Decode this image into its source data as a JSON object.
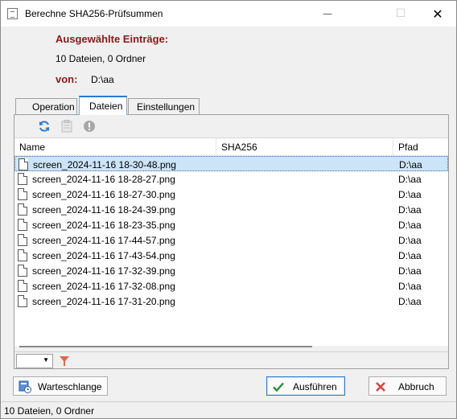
{
  "window": {
    "title": "Berechne SHA256-Prüfsummen"
  },
  "header": {
    "selected_label": "Ausgewählte Einträge:",
    "selected_summary": "10 Dateien, 0 Ordner",
    "from_label": "von:",
    "from_value": "D:\\aa"
  },
  "tabs": [
    {
      "label": "Operation",
      "active": false
    },
    {
      "label": "Dateien",
      "active": true
    },
    {
      "label": "Einstellungen",
      "active": false
    }
  ],
  "toolbar": {
    "icons": [
      "refresh-icon",
      "clipboard-icon",
      "info-icon"
    ]
  },
  "list": {
    "columns": [
      "Name",
      "SHA256",
      "Pfad"
    ],
    "rows": [
      {
        "name": "screen_2024-11-16 18-30-48.png",
        "sha256": "",
        "path": "D:\\aa",
        "selected": true
      },
      {
        "name": "screen_2024-11-16 18-28-27.png",
        "sha256": "",
        "path": "D:\\aa"
      },
      {
        "name": "screen_2024-11-16 18-27-30.png",
        "sha256": "",
        "path": "D:\\aa"
      },
      {
        "name": "screen_2024-11-16 18-24-39.png",
        "sha256": "",
        "path": "D:\\aa"
      },
      {
        "name": "screen_2024-11-16 18-23-35.png",
        "sha256": "",
        "path": "D:\\aa"
      },
      {
        "name": "screen_2024-11-16 17-44-57.png",
        "sha256": "",
        "path": "D:\\aa"
      },
      {
        "name": "screen_2024-11-16 17-43-54.png",
        "sha256": "",
        "path": "D:\\aa"
      },
      {
        "name": "screen_2024-11-16 17-32-39.png",
        "sha256": "",
        "path": "D:\\aa"
      },
      {
        "name": "screen_2024-11-16 17-32-08.png",
        "sha256": "",
        "path": "D:\\aa"
      },
      {
        "name": "screen_2024-11-16 17-31-20.png",
        "sha256": "",
        "path": "D:\\aa"
      }
    ]
  },
  "buttons": {
    "queue": "Warteschlange",
    "run": "Ausführen",
    "cancel": "Abbruch"
  },
  "status": {
    "text": "10 Dateien, 0 Ordner"
  },
  "colors": {
    "accent": "#2a7ad6",
    "header_label": "#8b1a1a",
    "selection": "#cce4f7",
    "cancel_icon": "#d9463a",
    "run_icon": "#2e8b3a"
  }
}
